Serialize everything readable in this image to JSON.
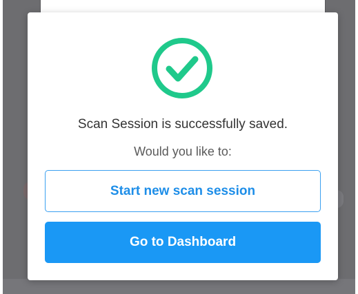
{
  "dialog": {
    "icon": "check-circle-icon",
    "message": "Scan Session is successfully saved.",
    "prompt": "Would you like to:",
    "secondary_button_label": "Start new scan session",
    "primary_button_label": "Go to Dashboard"
  },
  "colors": {
    "success": "#1fc98b",
    "primary": "#1a98f5",
    "overlay": "#6d6d70"
  }
}
